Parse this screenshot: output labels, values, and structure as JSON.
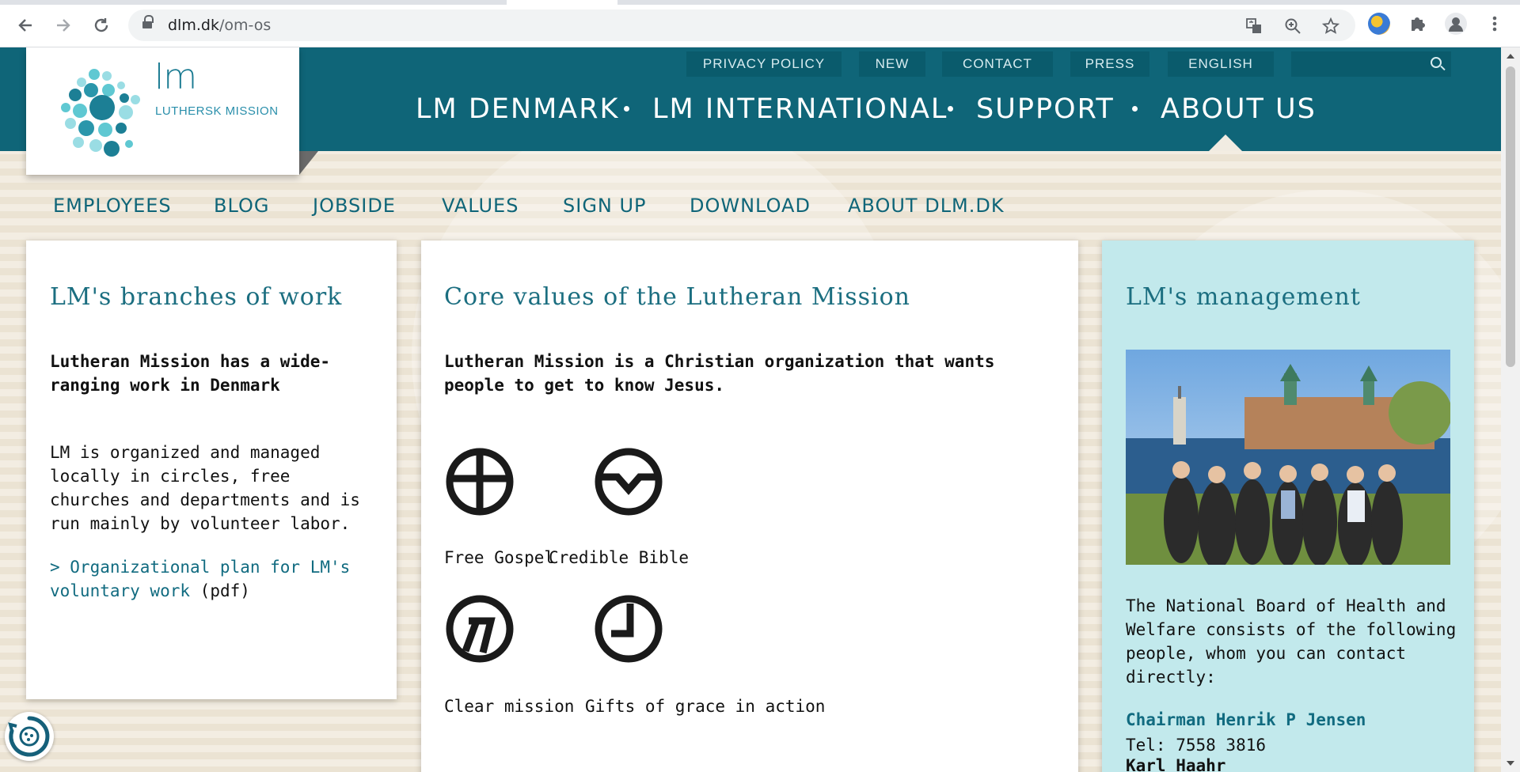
{
  "browser": {
    "url_domain": "dlm.dk",
    "url_path": "/om-os",
    "icons": [
      "back-icon",
      "forward-icon",
      "reload-icon",
      "lock-icon",
      "translate-icon",
      "zoom-icon",
      "bookmark-star-icon",
      "extension-icon",
      "puzzle-icon",
      "profile-icon",
      "menu-icon"
    ]
  },
  "logo": {
    "mark": "lm",
    "name": "LUTHERSK MISSION"
  },
  "utility_nav": [
    "PRIVACY POLICY",
    "NEW",
    "CONTACT",
    "PRESS",
    "ENGLISH"
  ],
  "main_nav": [
    "LM DENMARK",
    "LM INTERNATIONAL",
    "SUPPORT",
    "ABOUT US"
  ],
  "main_nav_active": "ABOUT US",
  "sub_nav": [
    "EMPLOYEES",
    "BLOG",
    "JOBSIDE",
    "VALUES",
    "SIGN UP",
    "DOWNLOAD",
    "ABOUT DLM.DK"
  ],
  "branches": {
    "title": "LM's branches of work",
    "lead": "Lutheran Mission has a wide-ranging work in Denmark",
    "body": "LM is organized and managed locally in circles, free churches and departments and is run mainly by volunteer labor.",
    "link": "> Organizational plan for LM's voluntary work",
    "link_suffix": "(pdf)"
  },
  "values": {
    "title": "Core values of the Lutheran Mission",
    "lead": "Lutheran Mission is a Christian organization that wants people to get to know Jesus.",
    "items": [
      {
        "label": "Free Gospel",
        "icon": "cross-circle-icon"
      },
      {
        "label": "Credible Bible",
        "icon": "open-book-circle-icon"
      },
      {
        "label": "Clear mission",
        "icon": "arrow-circle-icon"
      },
      {
        "label": "Gifts of grace in action",
        "icon": "clock-hands-circle-icon"
      }
    ]
  },
  "management": {
    "title": "LM's management",
    "photo": "group-photo-by-castle",
    "body": "The National Board of Health and Welfare consists of the following people, whom you can contact directly:",
    "contact_name": "Chairman Henrik P Jensen",
    "contact_tel": "Tel: 7558 3816",
    "next_name": "Karl Haahr"
  },
  "colors": {
    "brand_teal": "#0f6578",
    "card_teal": "#c2e9ec",
    "link": "#116b80"
  }
}
